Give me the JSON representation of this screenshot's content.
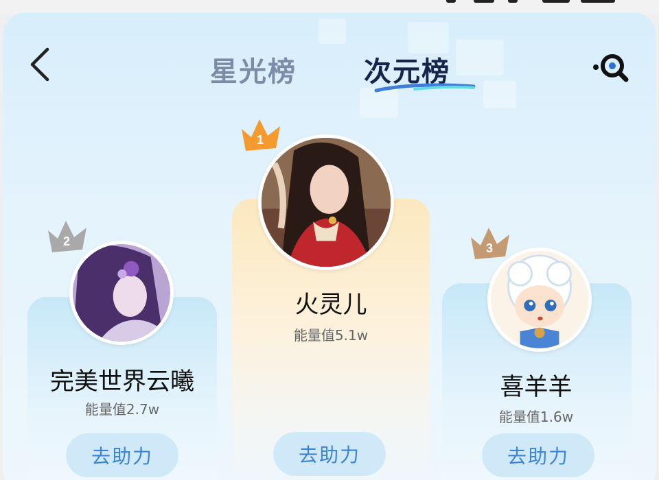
{
  "header": {
    "tabs": [
      {
        "label": "星光榜",
        "active": false
      },
      {
        "label": "次元榜",
        "active": true
      }
    ],
    "back_icon": "chevron-left-icon",
    "search_icon": "search-icon"
  },
  "ranking": [
    {
      "rank": "1",
      "name": "火灵儿",
      "energy": "能量值5.1w",
      "action": "去助力",
      "crown_color": "#f59a2e"
    },
    {
      "rank": "2",
      "name": "完美世界云曦",
      "energy": "能量值2.7w",
      "action": "去助力",
      "crown_color": "#a9a9a9"
    },
    {
      "rank": "3",
      "name": "喜羊羊",
      "energy": "能量值1.6w",
      "action": "去助力",
      "crown_color": "#c49a73"
    }
  ],
  "colors": {
    "accent": "#3b83d3",
    "active_tab": "#152448",
    "inactive_tab": "#7d8ba6"
  }
}
